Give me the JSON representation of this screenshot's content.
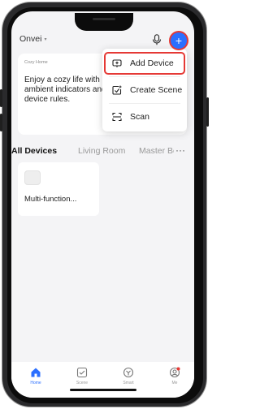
{
  "header": {
    "home_name": "Onvei",
    "caret": "▾"
  },
  "card": {
    "label": "Cozy Home",
    "text": "Enjoy a cozy life with ambient indicators and device rules."
  },
  "menu": {
    "items": [
      {
        "label": "Add Device",
        "icon": "add-device-icon",
        "selected": true
      },
      {
        "label": "Create Scene",
        "icon": "create-scene-icon",
        "selected": false
      },
      {
        "label": "Scan",
        "icon": "scan-icon",
        "selected": false
      }
    ]
  },
  "tabs": [
    {
      "label": "All Devices",
      "active": true
    },
    {
      "label": "Living Room",
      "active": false
    },
    {
      "label": "Master Be",
      "active": false
    }
  ],
  "tabs_more": "···",
  "devices": [
    {
      "name": "Multi-function..."
    }
  ],
  "nav": [
    {
      "label": "Home",
      "icon": "home-icon",
      "active": true
    },
    {
      "label": "Scene",
      "icon": "scene-icon",
      "active": false
    },
    {
      "label": "Smart",
      "icon": "smart-icon",
      "active": false
    },
    {
      "label": "Me",
      "icon": "me-icon",
      "active": false
    }
  ],
  "colors": {
    "accent": "#2b6fff",
    "highlight": "#e53935",
    "background": "#f4f4f6"
  }
}
